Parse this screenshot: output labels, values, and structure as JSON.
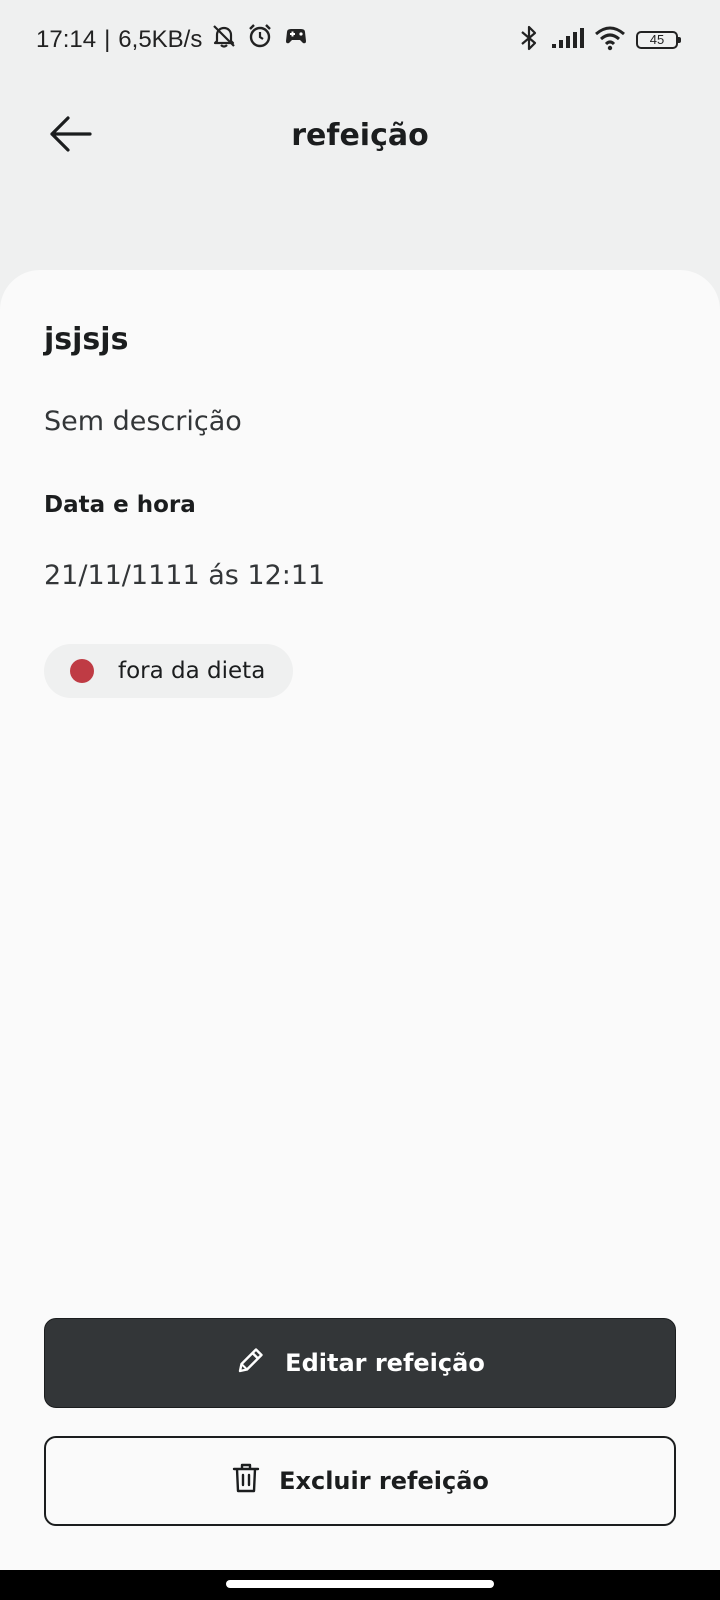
{
  "status_bar": {
    "time": "17:14",
    "separator": "|",
    "network_speed": "6,5KB/s",
    "battery_level": "45",
    "icons": [
      "notifications-off-icon",
      "alarm-icon",
      "game-controller-icon",
      "bluetooth-icon",
      "signal-icon",
      "wifi-icon",
      "battery-icon"
    ]
  },
  "header": {
    "back_icon": "arrow-left-icon",
    "title": "refeição"
  },
  "meal": {
    "name": "jsjsjs",
    "description": "Sem descrição",
    "datetime_label": "Data e hora",
    "datetime_value": "21/11/1111 ás 12:11",
    "diet_status": {
      "label": "fora da dieta",
      "color": "#BF3B44"
    }
  },
  "actions": {
    "edit": {
      "label": "Editar refeição",
      "icon": "pencil-icon"
    },
    "delete": {
      "label": "Excluir refeição",
      "icon": "trash-icon"
    }
  },
  "colors": {
    "background": "#EFF0F0",
    "card": "#FAFAFA",
    "primary_button": "#333638",
    "text": "#1B1D1E"
  }
}
